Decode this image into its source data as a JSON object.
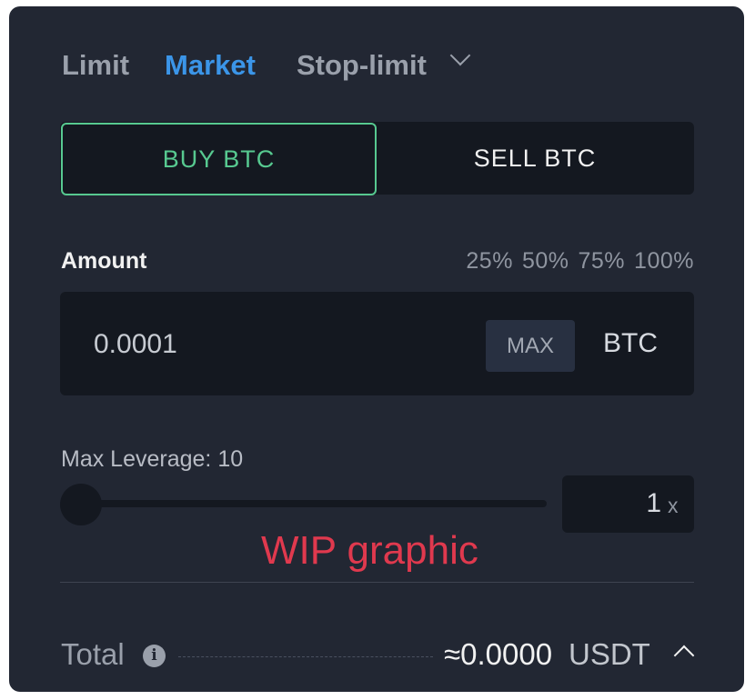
{
  "tabs": [
    {
      "label": "Limit"
    },
    {
      "label": "Market"
    },
    {
      "label": "Stop-limit"
    }
  ],
  "buy_label": "BUY BTC",
  "sell_label": "SELL BTC",
  "amount": {
    "label": "Amount",
    "percentages": [
      "25%",
      "50%",
      "75%",
      "100%"
    ],
    "value": "0.0001",
    "max_label": "MAX",
    "unit": "BTC"
  },
  "leverage": {
    "label": "Max Leverage: 10",
    "value": "1",
    "suffix": "x",
    "slider_fraction": 0
  },
  "wip_text": "WIP graphic",
  "total": {
    "label": "Total",
    "value": "≈0.0000",
    "unit": "USDT"
  },
  "colors": {
    "panel": "#222733",
    "accent_blue": "#3b95e8",
    "buy_green": "#57c990",
    "wip_red": "#e0394e"
  },
  "icons": [
    "chevron-down-icon",
    "info-icon",
    "chevron-up-icon"
  ]
}
